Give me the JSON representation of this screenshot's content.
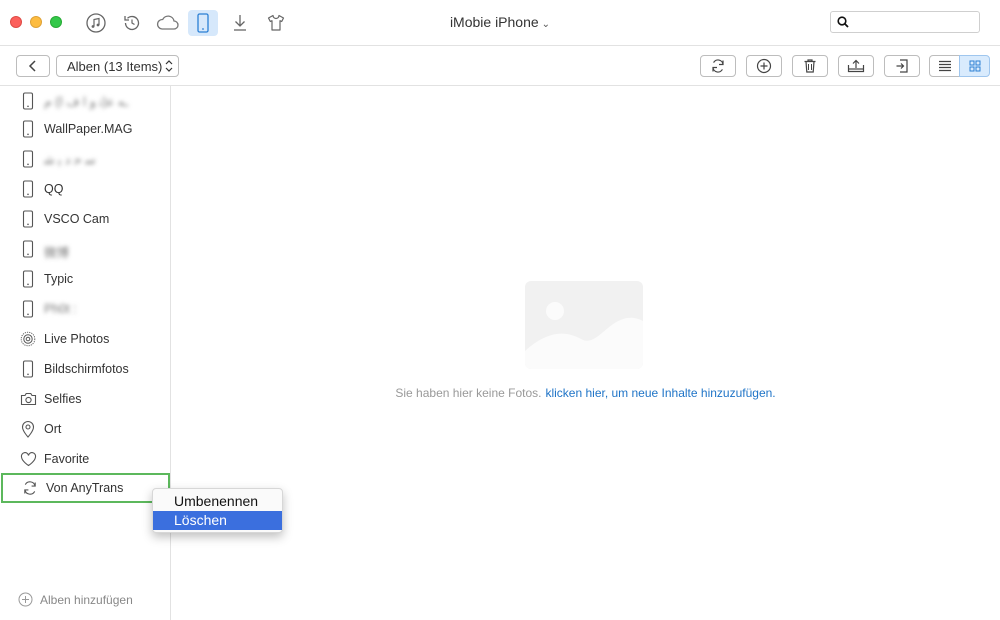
{
  "window": {
    "title": "iMobie iPhone",
    "title_chevron": "⌄",
    "search_placeholder": ""
  },
  "titlebar_icons": [
    "music-icon",
    "history-icon",
    "cloud-icon",
    "phone-icon",
    "download-icon",
    "shirt-icon"
  ],
  "toolbar": {
    "album_select": "Alben (13 Items)",
    "album_select_arrows": "▲▼"
  },
  "sidebar": {
    "items": [
      {
        "label": "ـه ﻋ(ﺗ ﻭ ﺍ ﻑ ﺍ) ﻡ",
        "icon": "phone-icon",
        "blurred": true
      },
      {
        "label": "WallPaper.MAG",
        "icon": "phone-icon",
        "blurred": false
      },
      {
        "label": "ﺳ ﺣ ﺩ ﻳ ﺷ",
        "icon": "phone-icon",
        "blurred": true
      },
      {
        "label": "QQ",
        "icon": "phone-icon",
        "blurred": false
      },
      {
        "label": "VSCO Cam",
        "icon": "phone-icon",
        "blurred": false
      },
      {
        "label": "微博",
        "icon": "phone-icon",
        "blurred": true
      },
      {
        "label": "Typic",
        "icon": "phone-icon",
        "blurred": false
      },
      {
        "label": "Ph0t :",
        "icon": "phone-icon",
        "blurred": true
      },
      {
        "label": "Live Photos",
        "icon": "live-photos-icon",
        "blurred": false
      },
      {
        "label": "Bildschirmfotos",
        "icon": "phone-icon",
        "blurred": false
      },
      {
        "label": "Selfies",
        "icon": "camera-icon",
        "blurred": false
      },
      {
        "label": "Ort",
        "icon": "location-pin-icon",
        "blurred": false
      },
      {
        "label": "Favorite",
        "icon": "heart-icon",
        "blurred": false
      },
      {
        "label": "Von AnyTrans",
        "icon": "sync-icon",
        "blurred": false,
        "selected": true
      }
    ],
    "add_album": "Alben hinzufügen"
  },
  "main": {
    "empty_text": "Sie haben hier keine Fotos.",
    "empty_link": "klicken hier, um neue Inhalte hinzuzufügen."
  },
  "context_menu": {
    "items": [
      {
        "label": "Umbenennen"
      },
      {
        "label": "Löschen",
        "highlighted": true
      }
    ]
  },
  "colors": {
    "accent_blue": "#1f74c7",
    "menu_highlight": "#3b6fde",
    "selected_border": "#5cb85c",
    "active_tab_bg": "#d6e8fb"
  }
}
